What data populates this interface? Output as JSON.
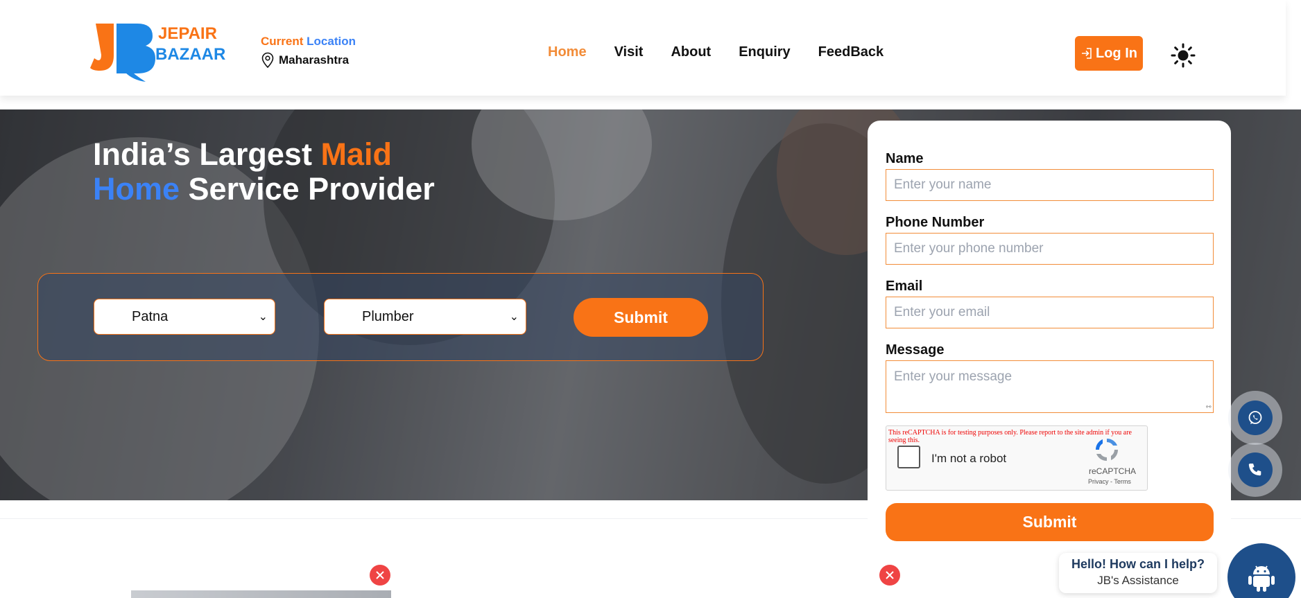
{
  "header": {
    "logo_text_top": "JEPAIR",
    "logo_text_bottom": "BAZAAR",
    "location_label_1": "Current",
    "location_label_2": "Location",
    "location_value": "Maharashtra",
    "nav": [
      "Home",
      "Visit",
      "About",
      "Enquiry",
      "FeedBack"
    ],
    "active_nav": "Home",
    "login_label": "Log In"
  },
  "hero": {
    "title_part1": "India’s Largest ",
    "title_highlight1": "Maid",
    "title_highlight2": "Home",
    "title_part2": " Service Provider",
    "city_select": "Patna",
    "service_select": "Plumber",
    "submit_label": "Submit"
  },
  "form": {
    "name_label": "Name",
    "name_placeholder": "Enter your name",
    "phone_label": "Phone Number",
    "phone_placeholder": "Enter your phone number",
    "email_label": "Email",
    "email_placeholder": "Enter your email",
    "message_label": "Message",
    "message_placeholder": "Enter your message",
    "captcha_warning": "This reCAPTCHA is for testing purposes only. Please report to the site admin if you are seeing this.",
    "captcha_label": "I'm not a robot",
    "captcha_brand": "reCAPTCHA",
    "captcha_terms": "Privacy - Terms",
    "submit_label": "Submit"
  },
  "assistant": {
    "greeting": "Hello! How can I help?",
    "name": "JB's Assistance"
  },
  "colors": {
    "accent": "#f97316",
    "blue": "#3b82f6",
    "float_button": "#1e4f8a",
    "close": "#ef4444"
  },
  "icons": [
    "location-pin-icon",
    "login-icon",
    "sun-icon",
    "whatsapp-icon",
    "phone-icon",
    "android-bot-icon",
    "close-icon",
    "recaptcha-icon"
  ]
}
